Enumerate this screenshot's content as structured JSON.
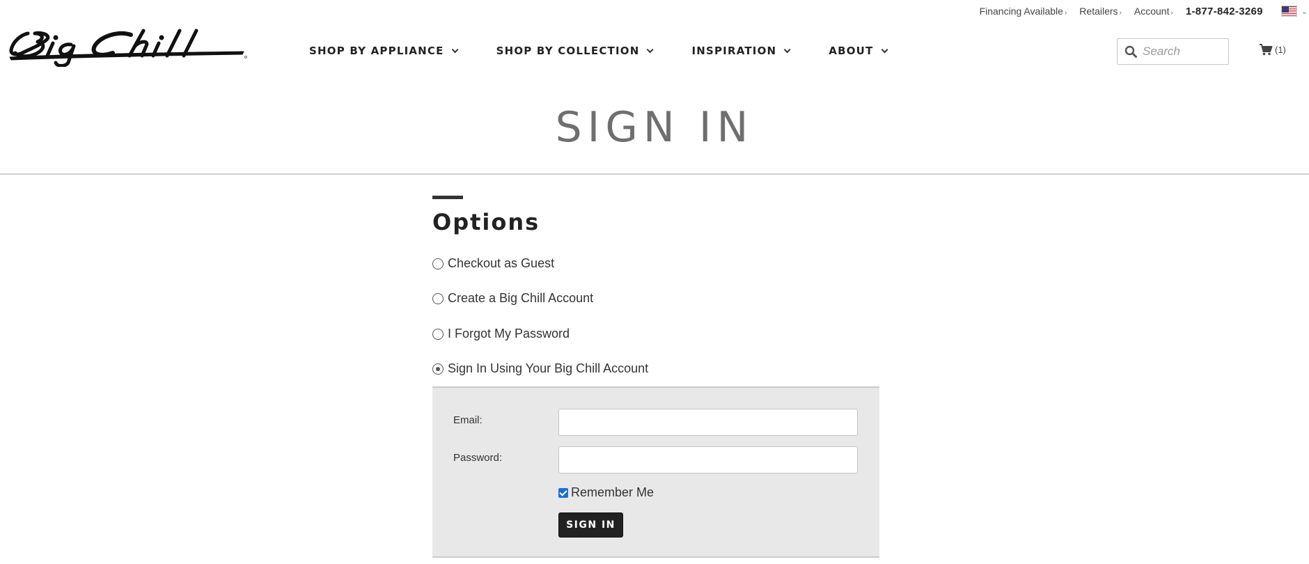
{
  "utility": {
    "financing": "Financing Available",
    "retailers": "Retailers",
    "account": "Account",
    "chevron": "›",
    "phone": "1-877-842-3269",
    "flag_icon": "us-flag-icon",
    "flag_dropdown": "⌄"
  },
  "brand": {
    "logo_icon": "big-chill-logo",
    "logo_color": "#111111"
  },
  "nav": {
    "items": [
      {
        "label": "SHOP BY APPLIANCE"
      },
      {
        "label": "SHOP BY COLLECTION"
      },
      {
        "label": "INSPIRATION"
      },
      {
        "label": "ABOUT"
      }
    ]
  },
  "search": {
    "placeholder": "Search",
    "icon": "search-icon"
  },
  "cart": {
    "icon": "cart-icon",
    "count": "(1)"
  },
  "page": {
    "title": "SIGN IN"
  },
  "options": {
    "heading": "Options",
    "items": [
      {
        "label": "Checkout as Guest",
        "selected": false
      },
      {
        "label": "Create a Big Chill Account",
        "selected": false
      },
      {
        "label": "I Forgot My Password",
        "selected": false
      },
      {
        "label": "Sign In Using Your Big Chill Account",
        "selected": true
      }
    ]
  },
  "login": {
    "email_label": "Email:",
    "email_value": "",
    "password_label": "Password:",
    "password_value": "",
    "remember_label": "Remember Me",
    "remember_checked": true,
    "submit_label": "SIGN IN"
  },
  "colors": {
    "panel_bg": "#e8e8e8",
    "button_bg": "#222222",
    "title_color": "#6f6f6f",
    "checkbox_color": "#1a6fd8"
  }
}
